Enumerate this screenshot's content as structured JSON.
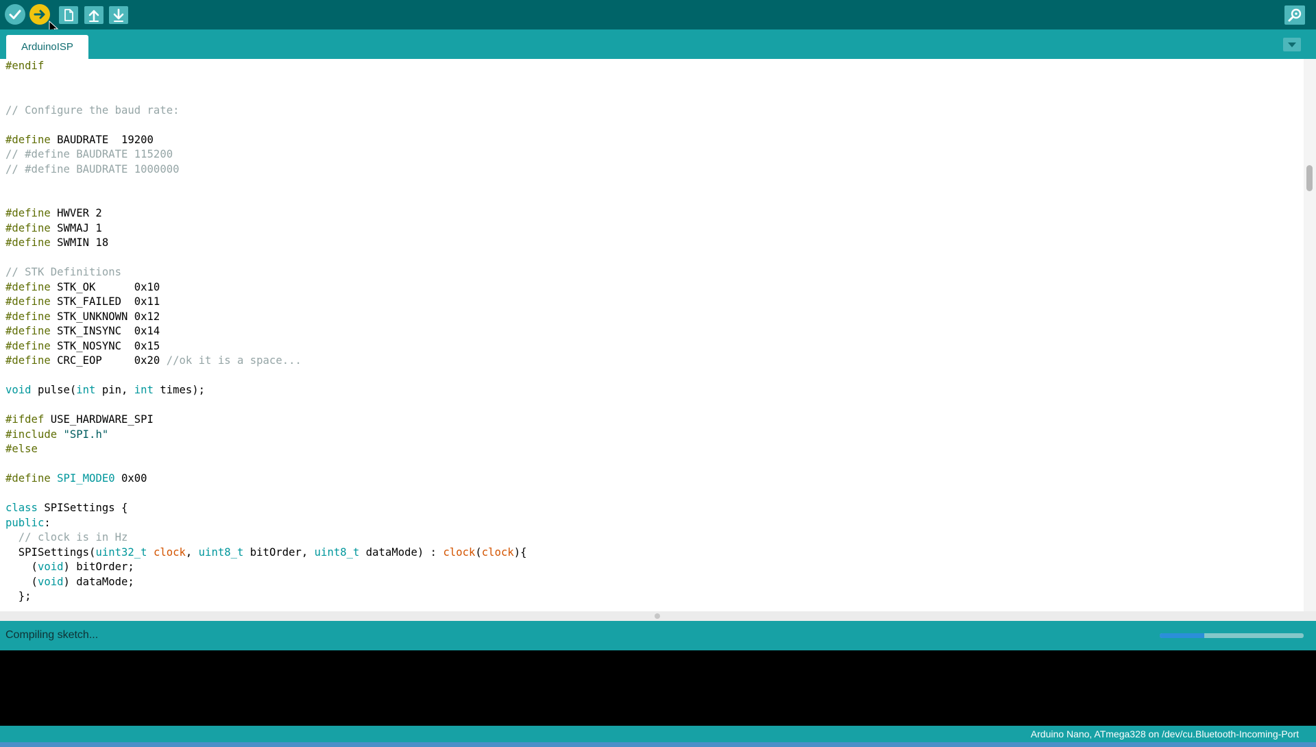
{
  "toolbar": {
    "buttons": [
      {
        "name": "verify",
        "icon": "checkmark-icon"
      },
      {
        "name": "upload",
        "icon": "arrow-right-icon",
        "active": true
      },
      {
        "name": "new",
        "icon": "document-icon"
      },
      {
        "name": "open",
        "icon": "arrow-up-icon"
      },
      {
        "name": "save",
        "icon": "arrow-down-icon"
      }
    ],
    "serial_monitor_icon": "magnifier-icon"
  },
  "tabs": [
    {
      "label": "ArduinoISP",
      "selected": true
    }
  ],
  "editor": {
    "lines": [
      "#endif",
      "",
      "",
      "// Configure the baud rate:",
      "",
      "#define BAUDRATE  19200",
      "// #define BAUDRATE 115200",
      "// #define BAUDRATE 1000000",
      "",
      "",
      "#define HWVER 2",
      "#define SWMAJ 1",
      "#define SWMIN 18",
      "",
      "// STK Definitions",
      "#define STK_OK      0x10",
      "#define STK_FAILED  0x11",
      "#define STK_UNKNOWN 0x12",
      "#define STK_INSYNC  0x14",
      "#define STK_NOSYNC  0x15",
      "#define CRC_EOP     0x20 //ok it is a space...",
      "",
      "void pulse(int pin, int times);",
      "",
      "#ifdef USE_HARDWARE_SPI",
      "#include \"SPI.h\"",
      "#else",
      "",
      "#define SPI_MODE0 0x00",
      "",
      "class SPISettings {",
      "public:",
      "  // clock is in Hz",
      "  SPISettings(uint32_t clock, uint8_t bitOrder, uint8_t dataMode) : clock(clock){",
      "    (void) bitOrder;",
      "    (void) dataMode;",
      "  };"
    ]
  },
  "status": {
    "message": "Compiling sketch...",
    "progress": 0.31
  },
  "console": {
    "lines": []
  },
  "footer": {
    "board_info": "Arduino Nano, ATmega328 on /dev/cu.Bluetooth-Incoming-Port"
  },
  "colors": {
    "toolbar": "#006468",
    "tabbar": "#17a1a5",
    "button": "#4db7bb",
    "button_active": "#f1c40f",
    "preprocessor": "#5e6d03",
    "keyword": "#00979c",
    "function": "#d35400",
    "comment": "#95a5a6",
    "progress_fill": "#2b8fd9"
  }
}
